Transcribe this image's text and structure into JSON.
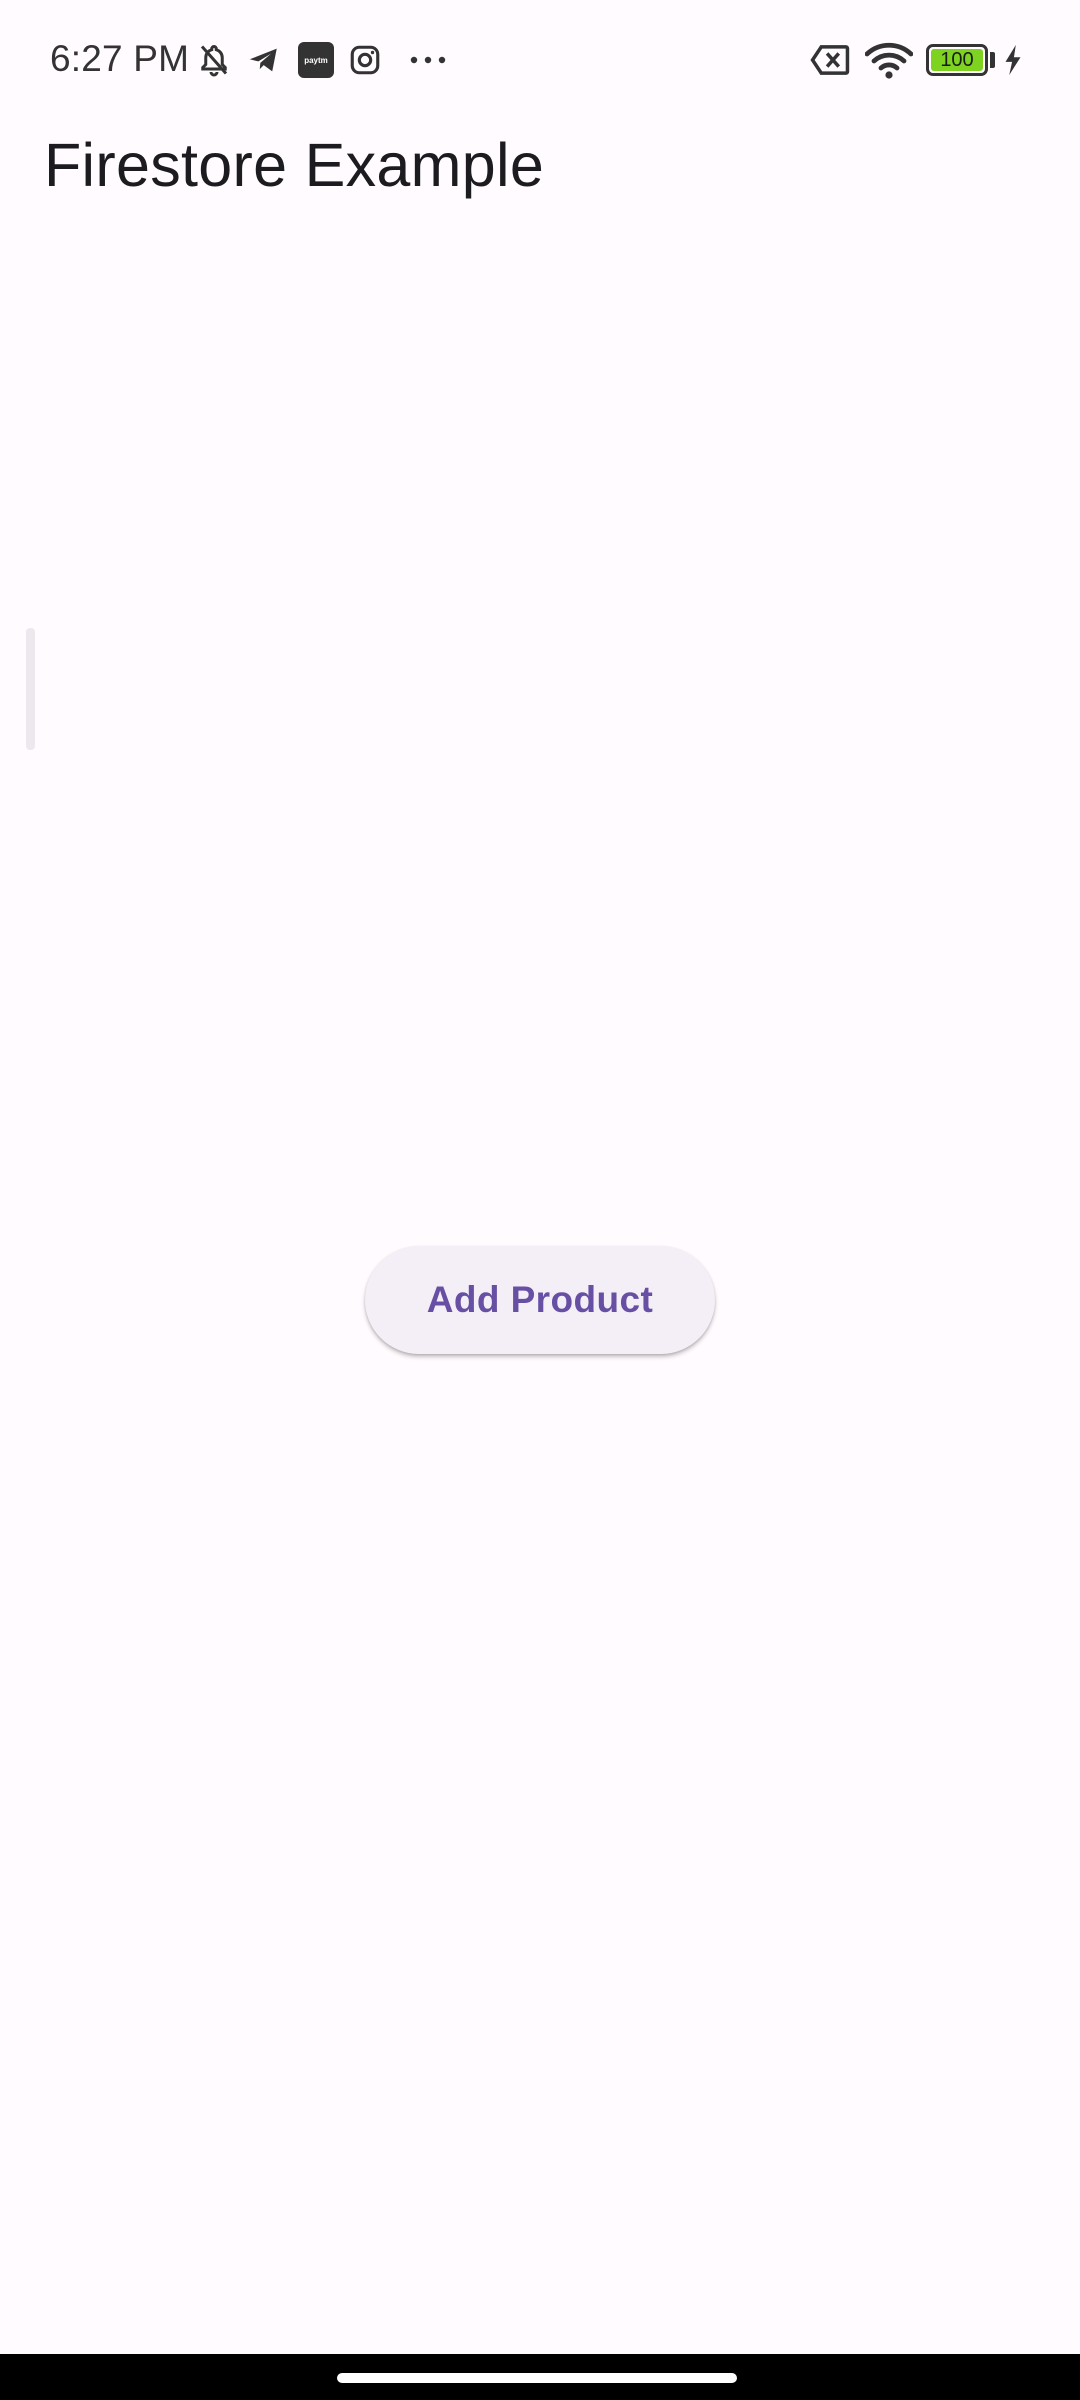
{
  "status_bar": {
    "time": "6:27 PM",
    "notification_icons": [
      "bell-off-icon",
      "telegram-icon",
      "paytm-icon",
      "instagram-icon",
      "more-dots-icon"
    ],
    "paytm_label": "paytm",
    "system_icons": [
      "no-sim-icon",
      "wifi-icon",
      "battery-icon",
      "charging-bolt-icon"
    ],
    "battery_level": "100",
    "battery_color": "#7ED321"
  },
  "app_bar": {
    "title": "Firestore Example"
  },
  "main": {
    "add_button_label": "Add Product"
  },
  "colors": {
    "background": "#FFFBFE",
    "button_bg": "#F4EFF6",
    "button_text": "#6750A4"
  }
}
